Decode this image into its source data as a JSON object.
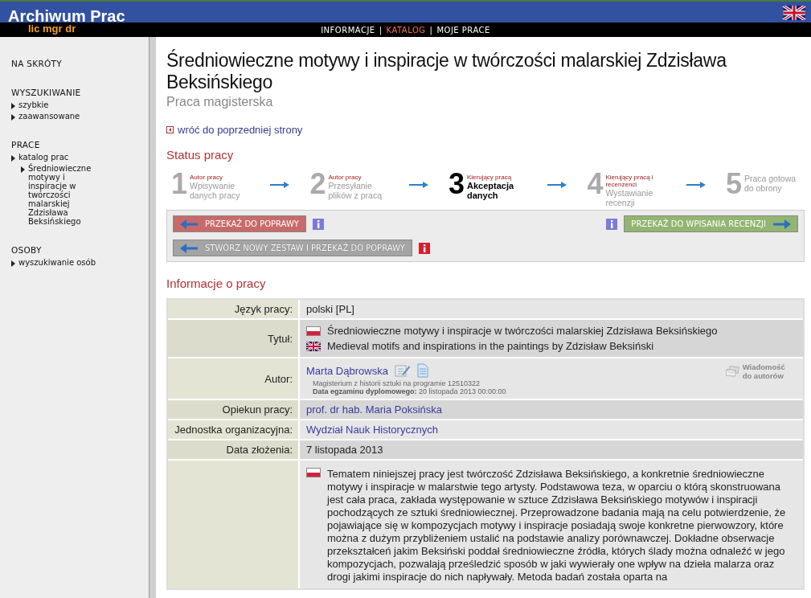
{
  "header": {
    "title": "Archiwum Prac",
    "subtitle": "lic mgr dr",
    "nav": [
      {
        "label": "INFORMACJE",
        "selected": false
      },
      {
        "label": "KATALOG",
        "selected": true
      },
      {
        "label": "MOJE PRACE",
        "selected": false
      }
    ],
    "separators": [
      "|",
      "|"
    ]
  },
  "sidebar": {
    "sections": [
      {
        "heading": "NA SKRÓTY"
      },
      {
        "heading": "WYSZUKIWANIE",
        "items": [
          {
            "label": "szybkie"
          },
          {
            "label": "zaawansowane"
          }
        ]
      },
      {
        "heading": "PRACE",
        "items": [
          {
            "label": "katalog prac",
            "children": [
              {
                "label": "Średniowieczne motywy i inspiracje w twórczości malarskiej Zdzisława Beksińskiego"
              }
            ]
          }
        ]
      },
      {
        "heading": "OSOBY",
        "items": [
          {
            "label": "wyszukiwanie osób"
          }
        ]
      }
    ]
  },
  "page": {
    "title": "Średniowieczne motywy i inspiracje w twórczości malarskiej Zdzisława Beksińskiego",
    "subtitle": "Praca magisterska",
    "back_link": "wróć do poprzedniej strony"
  },
  "status": {
    "heading": "Status pracy",
    "steps": [
      {
        "number": "1",
        "role": "Autor pracy",
        "label": "Wpisywanie danych pracy",
        "current": false
      },
      {
        "number": "2",
        "role": "Autor pracy",
        "label": "Przesyłanie plików z pracą",
        "current": false
      },
      {
        "number": "3",
        "role": "Kierujący pracą",
        "label": "Akceptacja danych",
        "current": true
      },
      {
        "number": "4",
        "role": "Kierujący pracą i recenzenci",
        "label": "Wystawianie recenzji",
        "current": false
      },
      {
        "number": "5",
        "label": "Praca gotowa do obrony",
        "current": false
      }
    ]
  },
  "actions": [
    {
      "label": "PRZEKAŻ DO POPRAWY",
      "color": "#c86a6a",
      "kind": "back",
      "info_icon": {
        "color": "#7b7bd8"
      }
    },
    {
      "label": "PRZEKAŻ DO WPISANIA RECENZJI",
      "color": "#93b572",
      "kind": "forward",
      "info_icon": {
        "color": "#7b7bd8"
      }
    },
    {
      "label": "STWÓRZ NOWY ZESTAW I PRZEKAŻ DO POPRAWY",
      "color": "#a4a4a4",
      "kind": "back",
      "info_icon": {
        "color": "#d81e2e"
      }
    }
  ],
  "info": {
    "heading": "Informacje o pracy",
    "rows": [
      {
        "kind": "text",
        "label": "Język pracy:",
        "value": "polski [PL]"
      },
      {
        "kind": "titles",
        "label": "Tytuł:",
        "titles": [
          {
            "kind": "polish",
            "text": "Średniowieczne motywy i inspiracje w twórczości malarskiej Zdzisława Beksińskiego"
          },
          {
            "kind": "english",
            "text": "Medieval motifs and inspirations in the paintings by Zdzisław Beksiński"
          }
        ]
      },
      {
        "kind": "author",
        "label": "Autor:",
        "name": "Marta Dąbrowska",
        "program": "Magisterium z historii sztuki na programie 12510322",
        "exam": "**Data egzaminu dyplomowego:** 20 listopada 2013 00:00:00",
        "message": "Wiadomość do autorów"
      },
      {
        "kind": "link",
        "label": "Opiekun pracy:",
        "value": "prof. dr hab. Maria Poksińska"
      },
      {
        "kind": "link",
        "label": "Jednostka organizacyjna:",
        "value": "Wydział Nauk Historycznych"
      },
      {
        "kind": "text",
        "label": "Data złożenia:",
        "value": "7 listopada 2013"
      },
      {
        "kind": "abstract",
        "flag": {
          "kind": "polish"
        },
        "value": "Tematem niniejszej pracy jest twórczość Zdzisława Beksińskiego, a konkretnie średniowieczne motywy i inspiracje w malarstwie tego artysty. Podstawowa teza, w oparciu o którą skonstruowana jest cała praca, zakłada występowanie w sztuce Zdzisława Beksińskiego motywów i inspiracji pochodzących ze sztuki średniowiecznej. Przeprowadzone badania mają na celu potwierdzenie, że pojawiające się w kompozycjach motywy i inspiracje posiadają swoje konkretne pierwowzory, które można z dużym przybliżeniem ustalić na podstawie analizy porównawczej. Dokładne obserwacje przekształceń jakim Beksiński poddał średniowieczne źródła, których ślady można odnaleźć w jego kompozycjach, pozwalają prześledzić sposób w jaki wywierały one wpływ na dzieła malarza oraz drogi jakimi inspiracje do nich napływały. Metoda badań została oparta na"
      }
    ]
  }
}
